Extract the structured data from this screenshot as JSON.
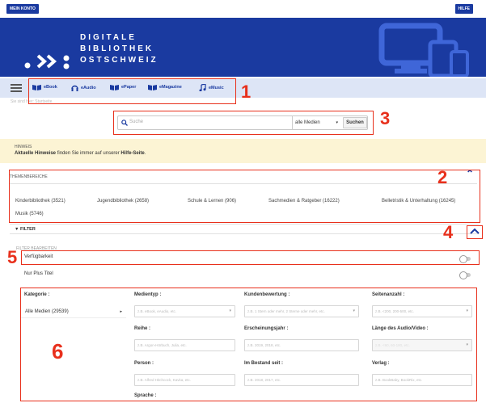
{
  "topbar": {
    "account_label": "MEIN KONTO",
    "help_label": "HILFE"
  },
  "brand": {
    "line1": "DIGITALE",
    "line2": "BIBLIOTHEK",
    "line3": "OSTSCHWEIZ",
    "color": "#1a3aa0"
  },
  "nav": {
    "items": [
      {
        "label": "eBook",
        "icon": "book-icon"
      },
      {
        "label": "eAudio",
        "icon": "headphones-icon"
      },
      {
        "label": "ePaper",
        "icon": "book-icon"
      },
      {
        "label": "eMagazine",
        "icon": "book-icon"
      },
      {
        "label": "eMusic",
        "icon": "music-note-icon"
      }
    ]
  },
  "breadcrumb": "Sie sind hier:  Startseite",
  "search": {
    "placeholder": "Suche",
    "media_select": "alle Medien",
    "submit_label": "Suchen"
  },
  "hint": {
    "title": "HINWEIS",
    "bold_prefix": "Aktuelle Hinweise",
    "middle": " finden Sie immer auf unserer ",
    "link": "Hilfe-Seite",
    "suffix": "."
  },
  "themen": {
    "heading": "THEMENBEREICHE",
    "items": [
      "Kinderbibliothek (3521)",
      "Jugendbibliothek (2658)",
      "Schule & Lernen (906)",
      "Sachmedien & Ratgeber (16222)",
      "Belletristik & Unterhaltung (16245)",
      "Musik (5746)"
    ]
  },
  "filter": {
    "label": "FILTER",
    "sub_heading": "FILTER BEARBEITEN",
    "availability_label": "Verfügbarkeit",
    "plus_label": "Nur Plus Titel",
    "kategorie_label": "Kategorie :",
    "kategorie_value": "Alle Medien (29539)",
    "fields": {
      "medientyp": {
        "label": "Medientyp :",
        "placeholder": "z.B. eBook, eAudio, etc."
      },
      "kundenbewertung": {
        "label": "Kundenbewertung :",
        "placeholder": "z.B. 1 Stern oder mehr, 2 Sterne oder mehr, etc."
      },
      "seitenanzahl": {
        "label": "Seitenanzahl :",
        "placeholder": "z.B. <200, 200-500, etc."
      },
      "reihe": {
        "label": "Reihe :",
        "placeholder": "z.B. Argon-Hörbuch, Julia, etc."
      },
      "erscheinungsjahr": {
        "label": "Erscheinungsjahr :",
        "placeholder": "z.B. 2019, 2018, etc."
      },
      "laenge": {
        "label": "Länge des Audio/Video :",
        "placeholder": "z.B. <60, 60-180, etc."
      },
      "person": {
        "label": "Person :",
        "placeholder": "z.B. Alfred Hitchcock, Kavka, etc."
      },
      "bestand": {
        "label": "Im Bestand seit :",
        "placeholder": "z.B. 2018, 2017, etc."
      },
      "verlag": {
        "label": "Verlag :",
        "placeholder": "z.B. BookBaby, BookRix, etc."
      },
      "sprache": {
        "label": "Sprache :"
      }
    }
  },
  "annotations": {
    "n1": "1",
    "n2": "2",
    "n3": "3",
    "n4": "4",
    "n5": "5",
    "n6": "6",
    "color": "#e8301c"
  }
}
